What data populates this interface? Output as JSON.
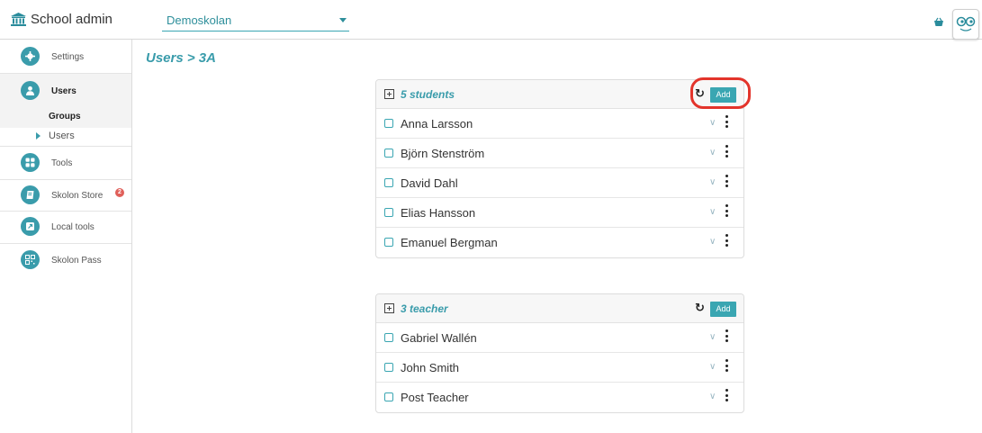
{
  "header": {
    "brand": "School admin",
    "school_select": "Demoskolan"
  },
  "sidebar": {
    "items": [
      {
        "label": "Settings",
        "icon": "gear-icon"
      },
      {
        "label": "Users",
        "icon": "person-icon"
      },
      {
        "label": "Tools",
        "icon": "grid-icon"
      },
      {
        "label": "Skolon Store",
        "icon": "book-icon",
        "badge": "2"
      },
      {
        "label": "Local tools",
        "icon": "external-link-icon"
      },
      {
        "label": "Skolon Pass",
        "icon": "qr-code-icon"
      }
    ],
    "subitems": {
      "groups": "Groups",
      "users": "Users"
    }
  },
  "main": {
    "breadcrumb": "Users > 3A",
    "students": {
      "title": "5 students",
      "add_label": "Add",
      "rows": [
        "Anna Larsson",
        "Björn Stenström",
        "David Dahl",
        "Elias Hansson",
        "Emanuel Bergman"
      ]
    },
    "teachers": {
      "title": "3 teacher",
      "add_label": "Add",
      "rows": [
        "Gabriel Wallén",
        "John Smith",
        "Post Teacher"
      ]
    }
  },
  "colors": {
    "accent": "#3aa6b2",
    "highlight": "#e3342b",
    "badge": "#e0605a"
  }
}
